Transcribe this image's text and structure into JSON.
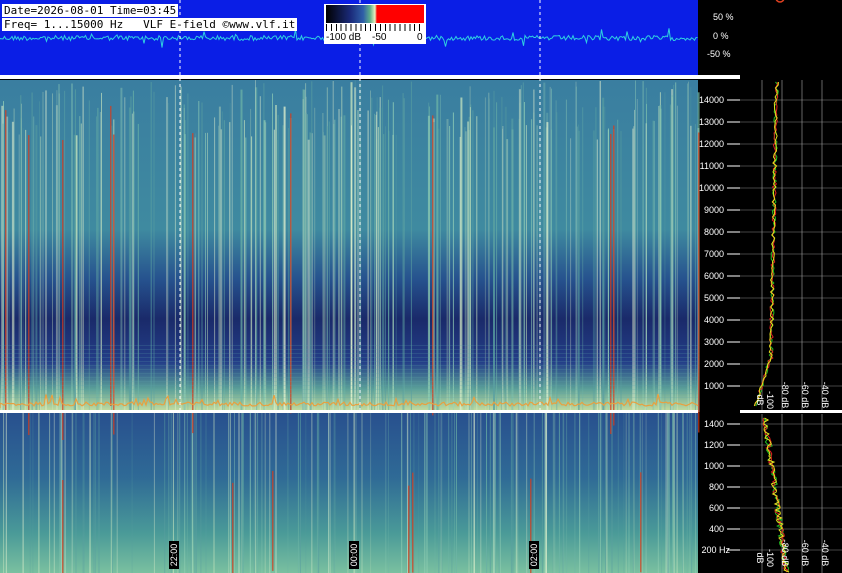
{
  "header": {
    "date_line": "Date=2026-08-01 Time=03:45",
    "freq_line": "Freq= 1...15000 Hz   VLF E-field ©www.vlf.it"
  },
  "colorbar": {
    "labels": [
      "-100 dB",
      "-50",
      "0"
    ],
    "colors": [
      "#000000",
      "#1a2a7a",
      "#2f5fa8",
      "#5fb08a",
      "#e8f0c0",
      "#ff0000"
    ]
  },
  "waveform": {
    "axis_labels": [
      "50 %",
      "0 %",
      "-50 %"
    ],
    "background": "#0a1ee6",
    "trace_color": "#2fd0e0"
  },
  "spectrogram_upper": {
    "freq_ticks": [
      "14000",
      "13000",
      "12000",
      "11000",
      "10000",
      "9000",
      "8000",
      "7000",
      "6000",
      "5000",
      "4000",
      "3000",
      "2000",
      "1000"
    ]
  },
  "spectrogram_lower": {
    "freq_ticks": [
      "1400",
      "1200",
      "1000",
      "800",
      "600",
      "400",
      "200 Hz"
    ]
  },
  "time_markers": [
    "22:00",
    "00:00",
    "02:00"
  ],
  "spectrum_panel_upper": {
    "db_labels": [
      "-100 dB",
      "-80 dB",
      "-60 dB",
      "-40 dB",
      "-20 dB"
    ]
  },
  "spectrum_panel_lower": {
    "db_labels": [
      "-100 dB",
      "-80 dB",
      "-60 dB",
      "-40 dB",
      "-20 dB"
    ]
  }
}
